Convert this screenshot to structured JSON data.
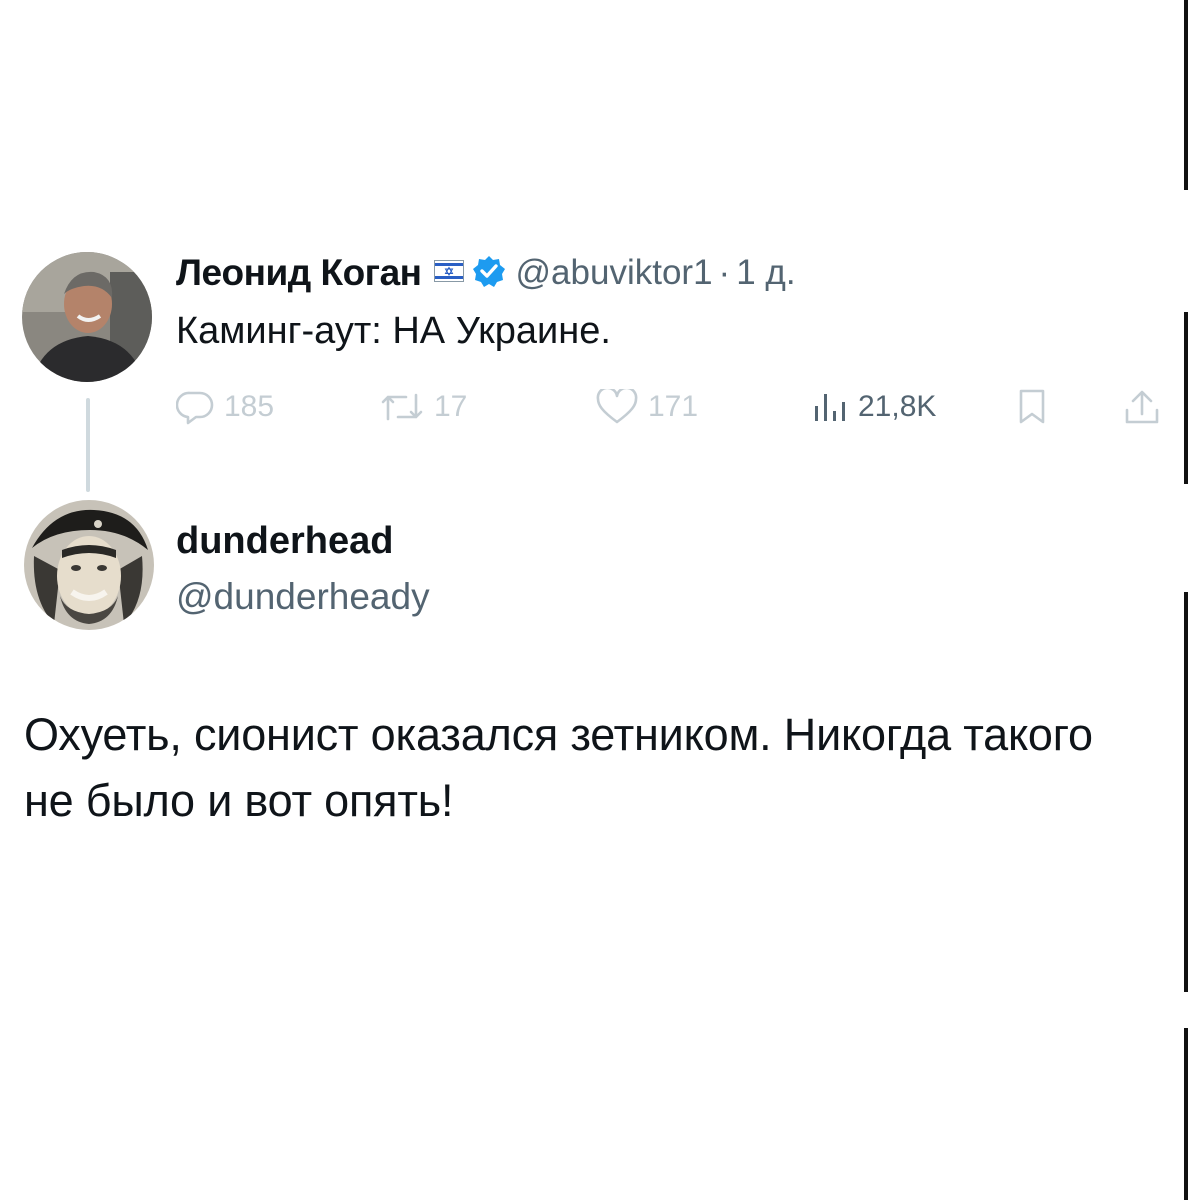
{
  "parent_tweet": {
    "author_name": "Леонид Коган",
    "handle": "@abuviktor1",
    "separator": "·",
    "time": "1 д.",
    "text": "Каминг-аут: НА Украине.",
    "flag_icon": "israel-flag-icon",
    "verified_icon": "verified-badge-icon",
    "actions": {
      "replies": "185",
      "retweets": "17",
      "likes": "171",
      "views": "21,8K"
    }
  },
  "reply_tweet": {
    "author_name": "dunderhead",
    "handle": "@dunderheady",
    "text": "Охуеть, сионист оказался зетником. Никогда такого не было и вот опять!"
  },
  "colors": {
    "text": "#0f1419",
    "secondary": "#536471",
    "faded_action": "#c4cdd3",
    "verified": "#1d9bf0",
    "thread_line": "#cfd9de"
  }
}
